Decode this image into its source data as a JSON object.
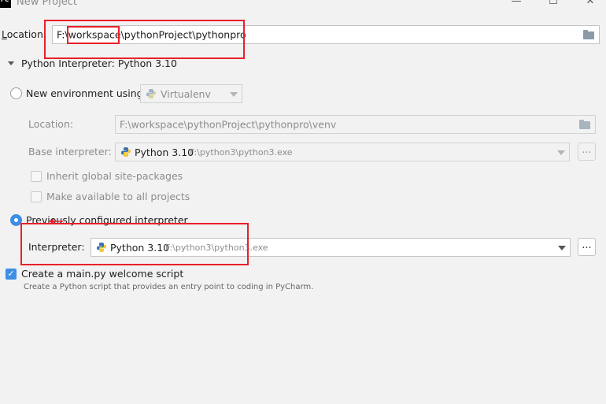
{
  "window": {
    "icon_text": "PC",
    "title": "New Project",
    "minimize_glyph": "—",
    "maximize_glyph": "☐",
    "close_glyph": "✕"
  },
  "location": {
    "label_prefix": "L",
    "label_rest": "ocation:",
    "value": "F:\\workspace\\pythonProject\\pythonpro"
  },
  "interpreter_section": {
    "title": "Python Interpreter: Python 3.10",
    "new_env": {
      "label": "New environment using",
      "tool": "Virtualenv",
      "location_label": "Location:",
      "location_value": "F:\\workspace\\pythonProject\\pythonpro\\venv",
      "base_label": "Base interpreter:",
      "base_name": "Python 3.10",
      "base_path": "F:\\python3\\python3.exe",
      "browse": "...",
      "inherit_label": "Inherit global site-packages",
      "available_label": "Make available to all projects"
    },
    "previous": {
      "label": "Previously configured interpreter",
      "interpreter_label": "Interpreter:",
      "interpreter_name": "Python 3.10",
      "interpreter_path": "F:\\python3\\python3.exe",
      "browse": "..."
    }
  },
  "welcome_script": {
    "label": "Create a main.py welcome script",
    "checked": true,
    "check_glyph": "✓",
    "description": "Create a Python script that provides an entry point to coding in PyCharm."
  },
  "colors": {
    "accent": "#3d8ee5",
    "annotation_red": "#e8202a",
    "background": "#f2f2f2"
  }
}
